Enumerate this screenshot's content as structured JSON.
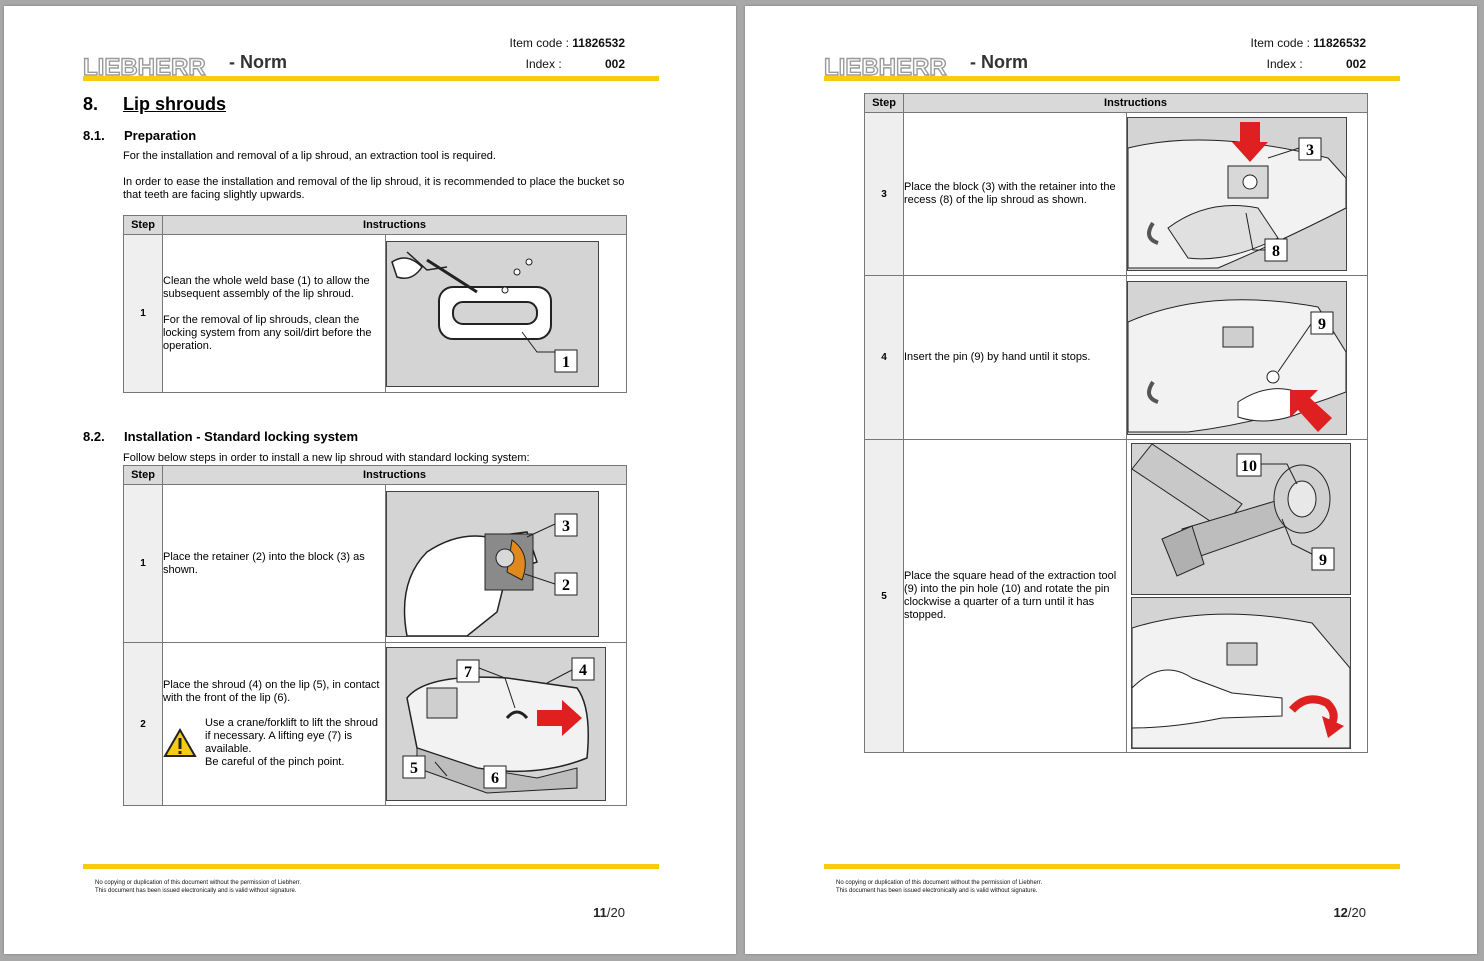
{
  "left_page": {
    "header": {
      "brand": "LIEBHERR",
      "norm": "- Norm",
      "item_code_label": "Item code :",
      "item_code_value": "11826532",
      "index_label": "Index :",
      "index_value": "002"
    },
    "section": {
      "number": "8.",
      "title": "Lip shrouds"
    },
    "prep": {
      "number": "8.1.",
      "title": "Preparation",
      "para1": "For the installation and removal of a lip shroud, an extraction tool is required.",
      "para2": "In order to ease the installation and removal of the lip shroud, it is recommended to place the bucket so that teeth are facing slightly upwards."
    },
    "table1": {
      "col_step": "Step",
      "col_instructions": "Instructions",
      "rows": [
        {
          "step": "1",
          "text1": "Clean the whole weld base (1) to allow the subsequent assembly of the lip shroud.",
          "text2": "For the removal of lip shrouds, clean the locking system from any soil/dirt before the operation.",
          "callouts": [
            "1"
          ]
        }
      ]
    },
    "install": {
      "number": "8.2.",
      "title": "Installation - Standard locking system",
      "intro": "Follow below steps in order to install a new lip shroud with standard locking system:"
    },
    "table2": {
      "col_step": "Step",
      "col_instructions": "Instructions",
      "rows": [
        {
          "step": "1",
          "text": "Place the retainer (2) into the block (3) as shown.",
          "callouts": [
            "3",
            "2"
          ]
        },
        {
          "step": "2",
          "text": "Place the shroud (4) on the lip (5), in contact with the front of the lip (6).",
          "warning": "Use a crane/forklift to lift the shroud if necessary. A lifting eye (7) is available.",
          "warning2": "Be careful of the pinch point.",
          "callouts": [
            "7",
            "4",
            "5",
            "6"
          ]
        }
      ]
    },
    "footer": {
      "note1": "No copying or duplication of this document without the permission of Liebherr.",
      "note2": "This document has been issued electronically and is valid without signature.",
      "page_current": "11",
      "page_total": "/20"
    }
  },
  "right_page": {
    "header": {
      "brand": "LIEBHERR",
      "norm": "- Norm",
      "item_code_label": "Item code :",
      "item_code_value": "11826532",
      "index_label": "Index :",
      "index_value": "002"
    },
    "table": {
      "col_step": "Step",
      "col_instructions": "Instructions",
      "rows": [
        {
          "step": "3",
          "text": "Place the block (3) with the retainer into the recess (8) of the lip shroud as shown.",
          "callouts": [
            "3",
            "8"
          ]
        },
        {
          "step": "4",
          "text": "Insert the pin (9) by hand until it stops.",
          "callouts": [
            "9"
          ]
        },
        {
          "step": "5",
          "text": "Place the square head of the extraction tool (9) into the pin hole (10) and rotate the pin clockwise a quarter of a turn until it has stopped.",
          "callouts": [
            "10",
            "9"
          ]
        }
      ]
    },
    "footer": {
      "note1": "No copying or duplication of this document without the permission of Liebherr.",
      "note2": "This document has been issued electronically and is valid without signature.",
      "page_current": "12",
      "page_total": "/20"
    }
  }
}
